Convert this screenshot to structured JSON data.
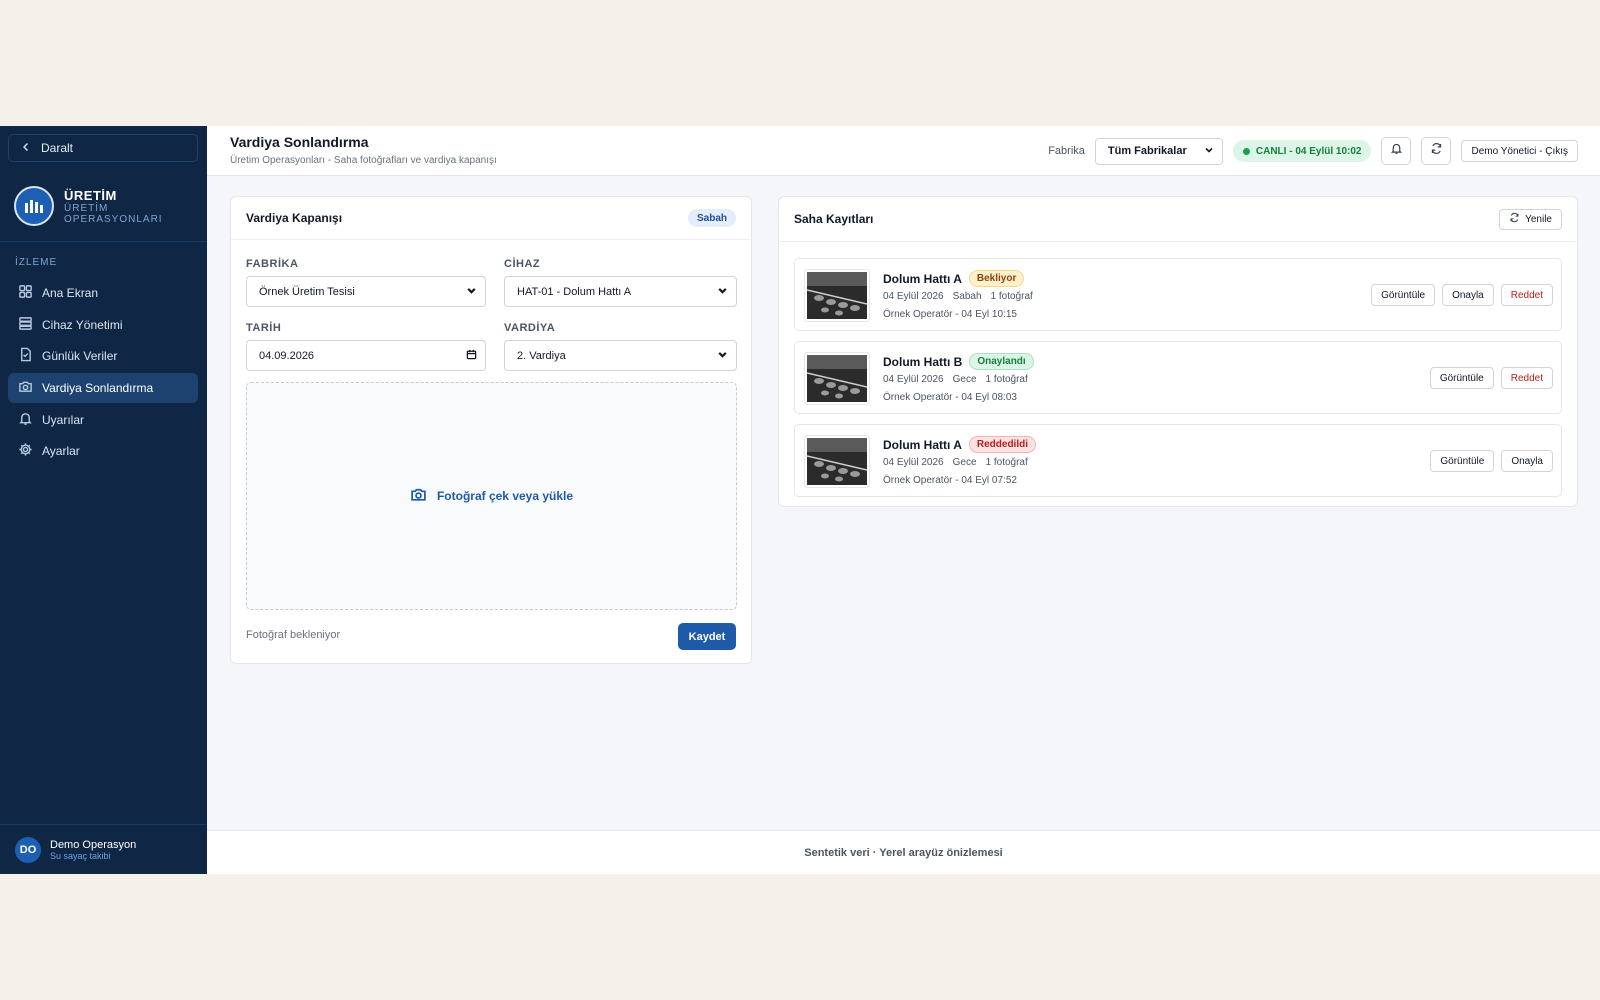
{
  "sidebar": {
    "collapse_label": "Daralt",
    "brand_title": "ÜRETİM",
    "brand_subtitle": "ÜRETİM OPERASYONLARI",
    "section_label": "İZLEME",
    "items": [
      {
        "label": "Ana Ekran",
        "icon": "grid-icon"
      },
      {
        "label": "Cihaz Yönetimi",
        "icon": "server-icon"
      },
      {
        "label": "Günlük Veriler",
        "icon": "document-icon"
      },
      {
        "label": "Vardiya Sonlandırma",
        "icon": "camera-icon",
        "active": true
      },
      {
        "label": "Uyarılar",
        "icon": "bell-icon"
      },
      {
        "label": "Ayarlar",
        "icon": "gear-icon"
      }
    ],
    "user": {
      "initials": "DO",
      "name": "Demo Operasyon",
      "subtitle": "Su sayaç takibi"
    }
  },
  "header": {
    "title": "Vardiya Sonlandırma",
    "subtitle": "Üretim Operasyonları - Saha fotoğrafları ve vardiya kapanışı",
    "factory_label": "Fabrika",
    "factory_value": "Tüm Fabrikalar",
    "live_badge": "CANLI - 04 Eylül 10:02",
    "logout_label": "Demo Yönetici - Çıkış"
  },
  "shift_form": {
    "title": "Vardiya Kapanışı",
    "shift_badge": "Sabah",
    "factory_label": "FABRİKA",
    "factory_value": "Örnek Üretim Tesisi",
    "device_label": "CİHAZ",
    "device_value": "HAT-01 - Dolum Hattı A",
    "date_label": "TARİH",
    "date_value": "04.09.2026",
    "shift_label": "VARDİYA",
    "shift_value": "2. Vardiya",
    "upload_label": "Fotoğraf çek veya yükle",
    "status_text": "Fotoğraf bekleniyor",
    "save_label": "Kaydet"
  },
  "records": {
    "title": "Saha Kayıtları",
    "refresh_label": "Yenile",
    "items": [
      {
        "line": "Dolum Hattı A",
        "status": "Bekliyor",
        "status_kind": "wait",
        "date": "04 Eylül 2026",
        "shift": "Sabah",
        "photos": "1 fotoğraf",
        "operator": "Örnek Operatör - 04 Eyl 10:15",
        "actions": [
          "Görüntüle",
          "Onayla",
          "Reddet"
        ]
      },
      {
        "line": "Dolum Hattı B",
        "status": "Onaylandı",
        "status_kind": "ok",
        "date": "04 Eylül 2026",
        "shift": "Gece",
        "photos": "1 fotoğraf",
        "operator": "Örnek Operatör - 04 Eyl 08:03",
        "actions": [
          "Görüntüle",
          "Reddet"
        ]
      },
      {
        "line": "Dolum Hattı A",
        "status": "Reddedildi",
        "status_kind": "rej",
        "date": "04 Eylül 2026",
        "shift": "Gece",
        "photos": "1 fotoğraf",
        "operator": "Örnek Operatör - 04 Eyl 07:52",
        "actions": [
          "Görüntüle",
          "Onayla"
        ]
      }
    ]
  },
  "footer": {
    "text": "Sentetik veri · Yerel arayüz önizlemesi"
  }
}
